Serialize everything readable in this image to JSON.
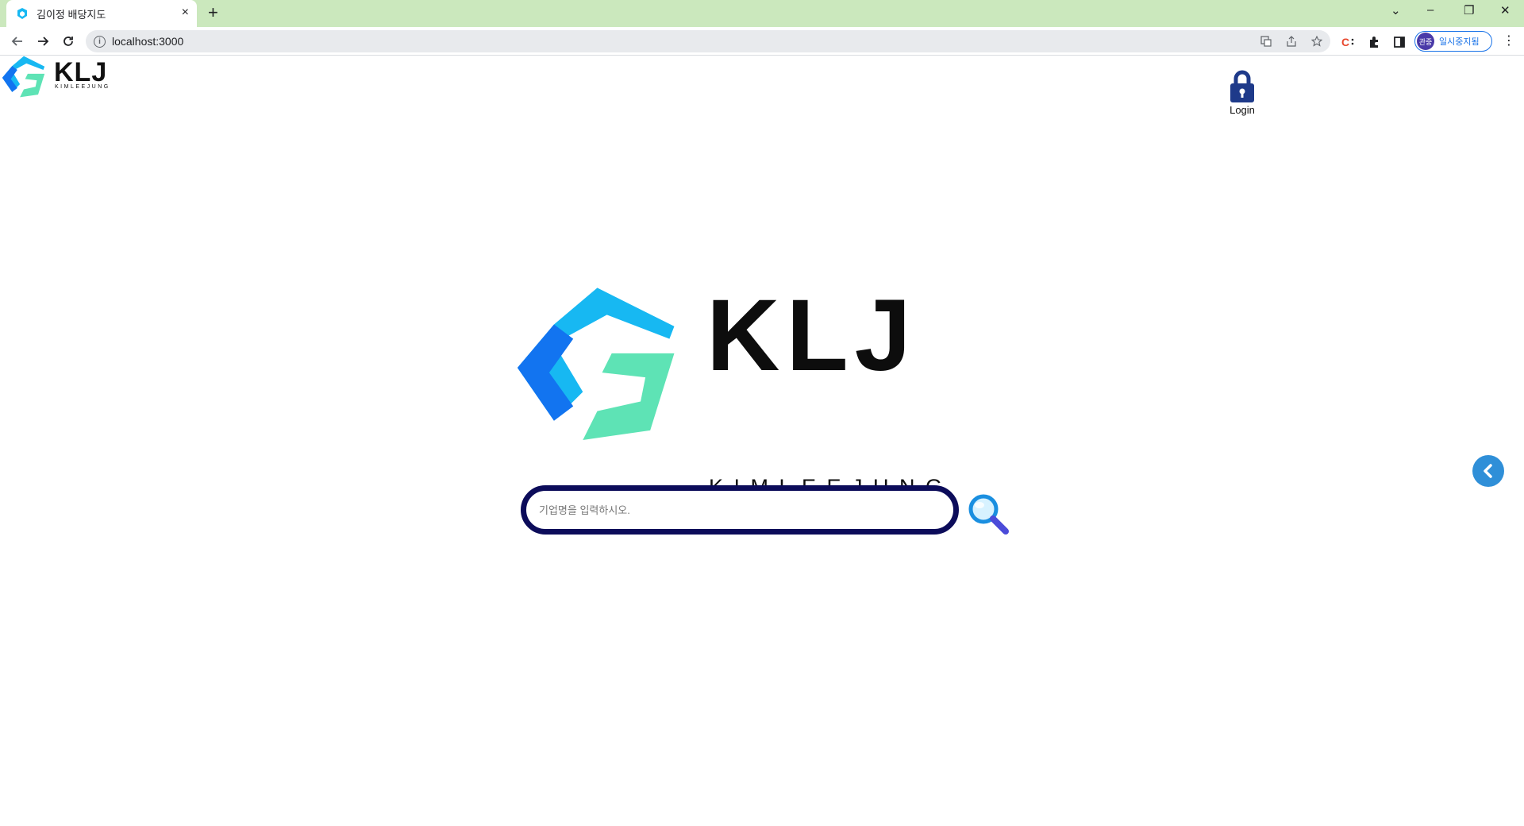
{
  "browser": {
    "tab_title": "김이정 배당지도",
    "tab_close": "×",
    "new_tab": "+",
    "url": "localhost:3000",
    "profile_avatar": "관중",
    "profile_label": "일시중지됨",
    "win_minimize": "–",
    "win_restore": "❐",
    "win_close": "✕",
    "tab_search": "⌄",
    "menu": "⋮"
  },
  "header": {
    "logo_text": "KLJ",
    "logo_subtext": "KIMLEEJUNG",
    "login_label": "Login"
  },
  "hero": {
    "title": "KLJ",
    "subtitle": "KIMLEEJUNG"
  },
  "search": {
    "placeholder": "기업명을 입력하시오.",
    "value": ""
  },
  "colors": {
    "tabstrip": "#cbe8bd",
    "search_border": "#0c0c5a",
    "lock": "#1e3a8a",
    "side_toggle": "#2f8fd8",
    "logo_blue_dark": "#1274f0",
    "logo_blue_light": "#17b8f2",
    "logo_green": "#5ee3b5"
  }
}
